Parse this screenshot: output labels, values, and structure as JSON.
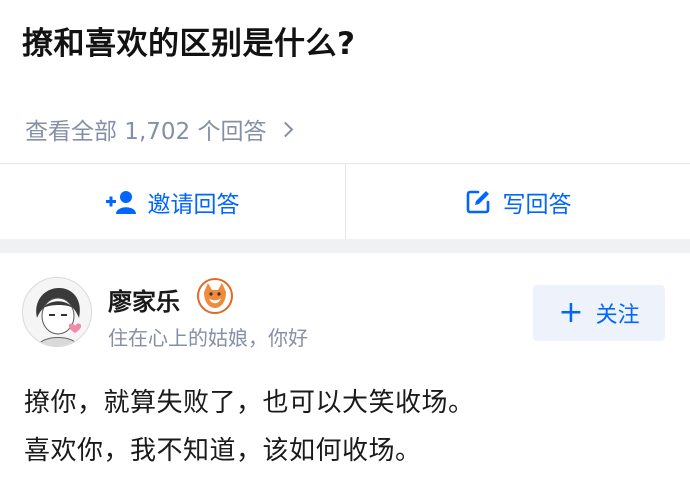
{
  "question": {
    "title": "撩和喜欢的区别是什么?"
  },
  "answers_link": {
    "label": "查看全部 1,702 个回答"
  },
  "actions": {
    "invite_label": "邀请回答",
    "write_label": "写回答"
  },
  "answer": {
    "author": {
      "name": "廖家乐",
      "bio": "住在心上的姑娘，你好",
      "badge_icon": "fox-badge-icon",
      "avatar_icon": "anime-boy-avatar"
    },
    "follow_label": "关注",
    "lines": [
      "撩你，就算失败了，也可以大笑收场。",
      "喜欢你，我不知道，该如何收场。"
    ]
  },
  "colors": {
    "accent": "#0066ff",
    "muted": "#8590a6",
    "follow_bg": "#eef3fb",
    "band": "#f0f1f3"
  }
}
